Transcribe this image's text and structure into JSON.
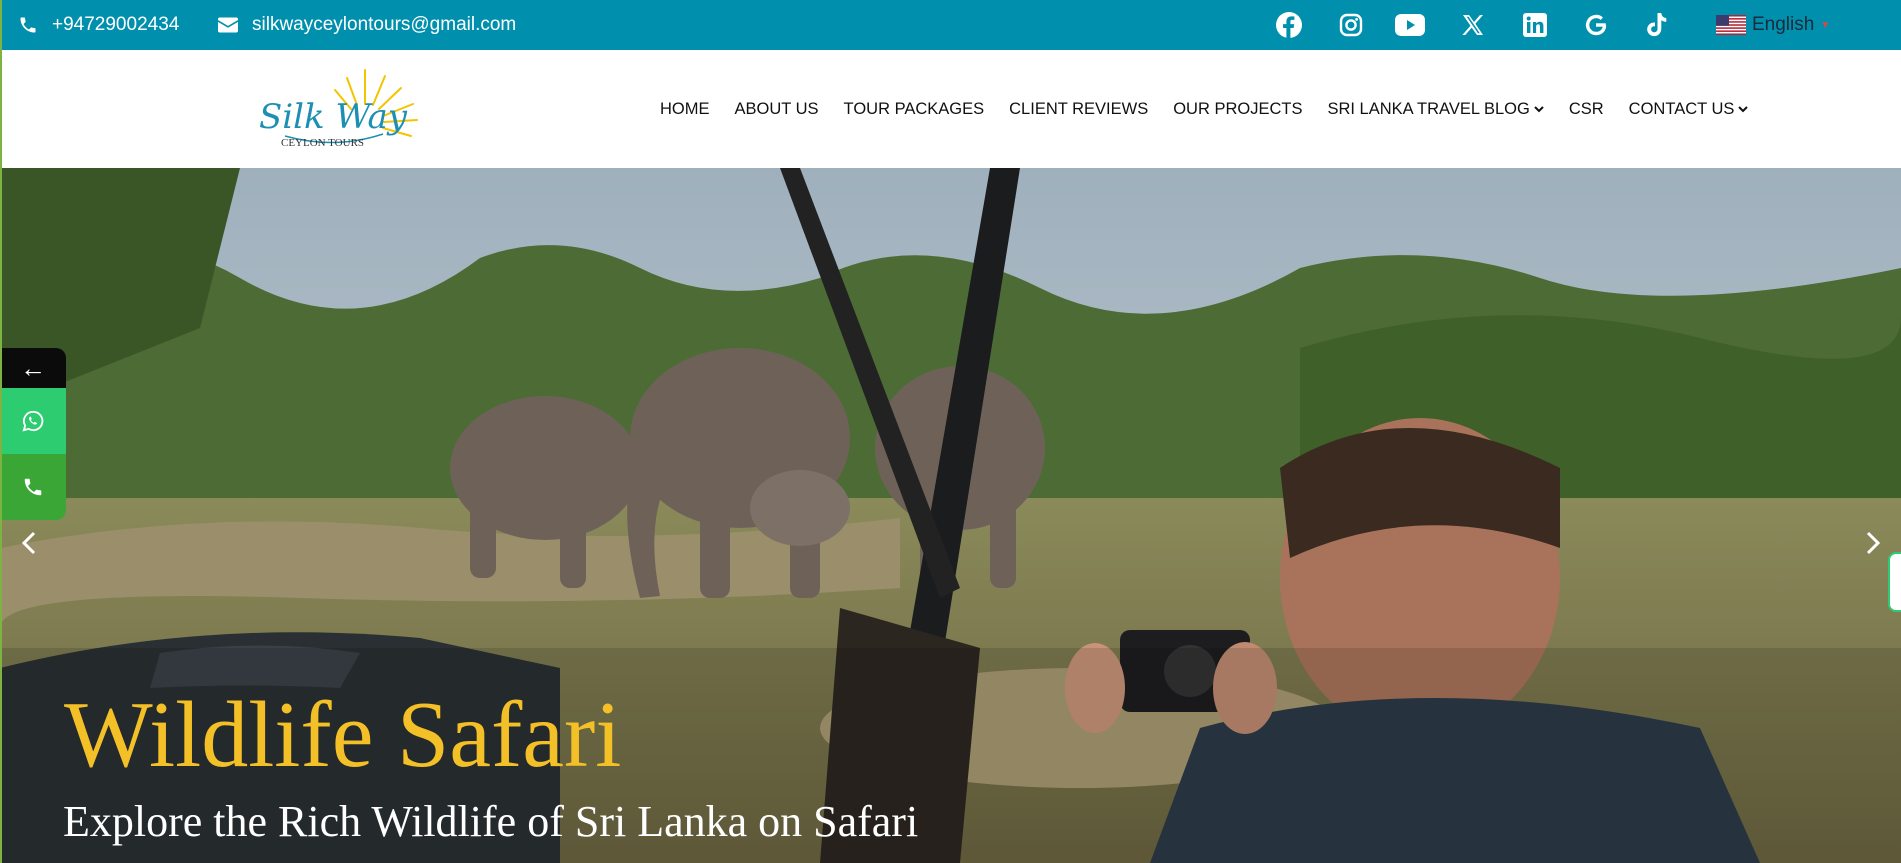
{
  "topbar": {
    "phone": "+94729002434",
    "email": "silkwayceylontours@gmail.com",
    "social_icons": [
      "facebook-icon",
      "instagram-icon",
      "youtube-icon",
      "x-icon",
      "linkedin-icon",
      "google-icon",
      "tiktok-icon"
    ],
    "language": "English"
  },
  "logo": {
    "line1": "Silk Way",
    "line2": "CEYLON TOURS"
  },
  "nav": {
    "items": [
      {
        "label": "HOME"
      },
      {
        "label": "ABOUT US"
      },
      {
        "label": "TOUR PACKAGES"
      },
      {
        "label": "CLIENT REVIEWS"
      },
      {
        "label": "OUR PROJECTS"
      },
      {
        "label": "SRI LANKA TRAVEL BLOG"
      },
      {
        "label": "CSR"
      },
      {
        "label": "CONTACT US"
      }
    ]
  },
  "hero": {
    "title": "Wildlife Safari",
    "subtitle": "Explore the Rich Wildlife of Sri Lanka on Safari"
  },
  "float_widget": {
    "toggle_label": "←"
  },
  "colors": {
    "topbar_bg": "#0090ad",
    "title": "#f4c027",
    "whatsapp": "#2ecc71",
    "call": "#3aa636",
    "logo_teal": "#1c8fb3",
    "logo_sun": "#f2c500"
  }
}
